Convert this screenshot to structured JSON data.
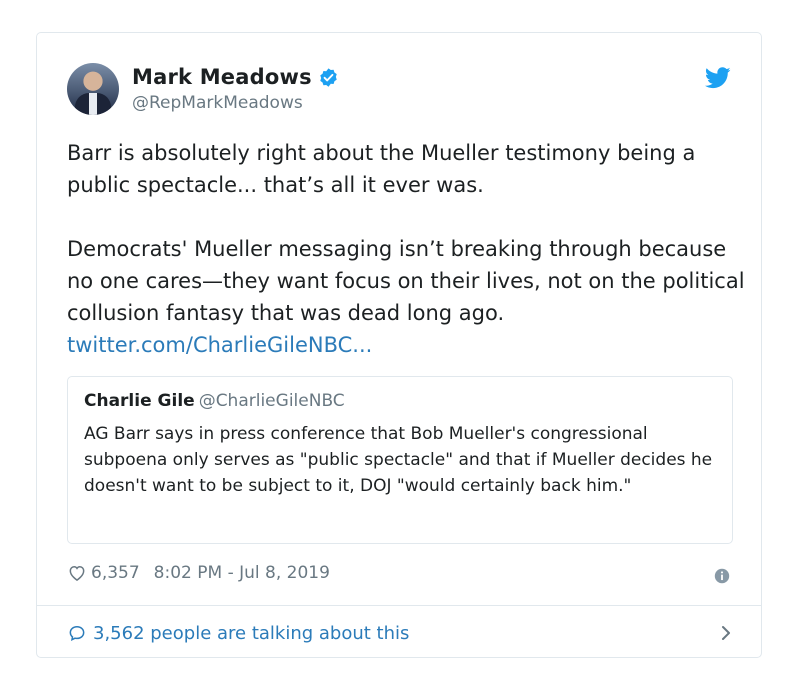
{
  "author": {
    "display_name": "Mark Meadows",
    "handle": "@RepMarkMeadows",
    "verified": true
  },
  "tweet": {
    "text": "Barr is absolutely right about the Mueller testimony being a public spectacle... that’s all it ever was.\n\nDemocrats' Mueller messaging isn’t breaking through because no one cares—they want focus on their lives, not on the political collusion fantasy that was dead long ago. ",
    "link": "twitter.com/CharlieGileNBC..."
  },
  "quoted_tweet": {
    "display_name": "Charlie Gile",
    "handle": "@CharlieGileNBC",
    "text": "AG Barr says in press conference that Bob Mueller's congressional subpoena only serves as \"public spectacle\" and that if Mueller decides he doesn't want to be subject to it, DOJ \"would certainly back him.\""
  },
  "meta": {
    "likes": "6,357",
    "timestamp": "8:02 PM - Jul 8, 2019"
  },
  "footer": {
    "talking": "3,562 people are talking about this"
  },
  "colors": {
    "accent": "#2b7bb9",
    "twitter_blue": "#1da1f2",
    "text": "#1c2022",
    "muted": "#697882",
    "border": "#e1e8ed"
  },
  "icons": [
    "verified-badge-icon",
    "twitter-bird-icon",
    "heart-icon",
    "info-icon",
    "speech-bubble-icon",
    "chevron-right-icon"
  ]
}
